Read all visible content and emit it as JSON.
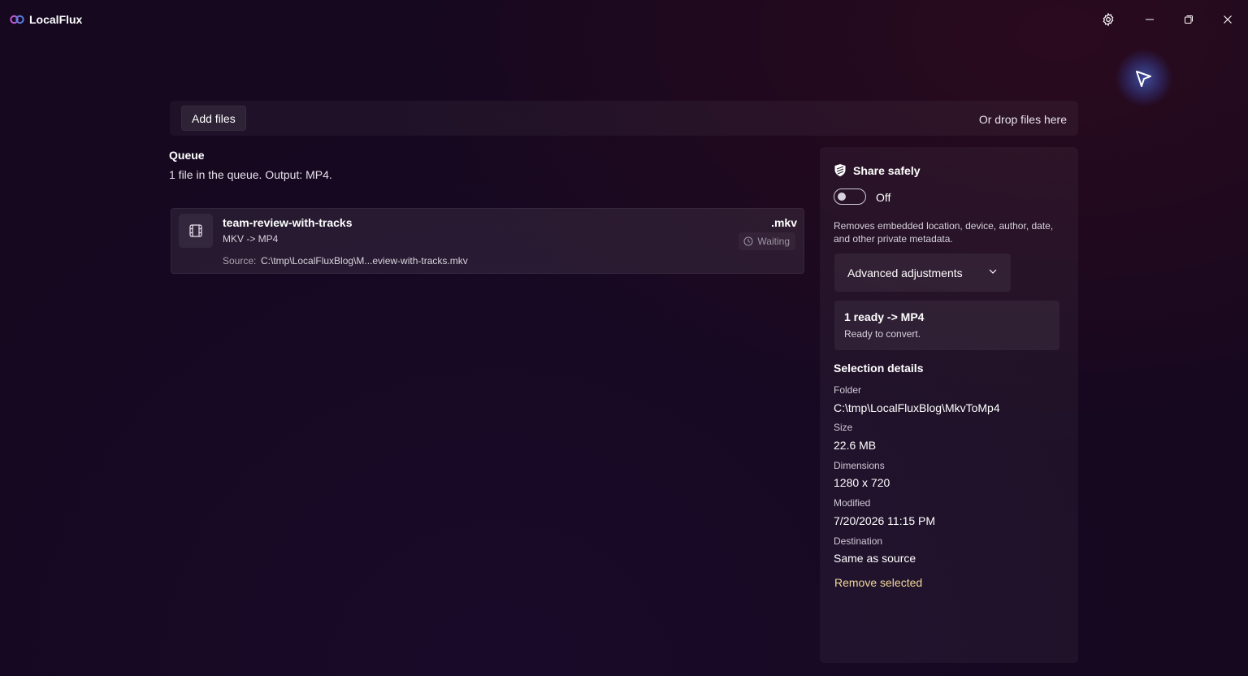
{
  "app": {
    "title": "LocalFlux"
  },
  "titlebar": {
    "icons": [
      "gear-icon",
      "minimize-icon",
      "restore-icon",
      "close-icon"
    ]
  },
  "dropbar": {
    "add_files_label": "Add files",
    "drop_hint": "Or drop files here"
  },
  "queue": {
    "heading": "Queue",
    "summary": "1 file in the queue. Output: MP4.",
    "items": [
      {
        "name": "team-review-with-tracks",
        "conversion": "MKV -> MP4",
        "source_label": "Source:",
        "source_path": "C:\\tmp\\LocalFluxBlog\\M...eview-with-tracks.mkv",
        "extension": ".mkv",
        "status": "Waiting"
      }
    ]
  },
  "share_safely": {
    "title": "Share safely",
    "toggle_state": "Off",
    "description": "Removes embedded location, device, author, date, and other private metadata."
  },
  "advanced": {
    "label": "Advanced adjustments"
  },
  "ready": {
    "title": "1 ready -> MP4",
    "subtitle": "Ready to convert."
  },
  "selection": {
    "heading": "Selection details",
    "folder_label": "Folder",
    "folder_value": "C:\\tmp\\LocalFluxBlog\\MkvToMp4",
    "size_label": "Size",
    "size_value": "22.6 MB",
    "dimensions_label": "Dimensions",
    "dimensions_value": "1280 x 720",
    "modified_label": "Modified",
    "modified_value": "7/20/2026 11:15 PM",
    "destination_label": "Destination",
    "destination_value": "Same as source",
    "remove_label": "Remove selected"
  },
  "colors": {
    "background": "#15081f",
    "accent_link": "#f1d99a"
  }
}
